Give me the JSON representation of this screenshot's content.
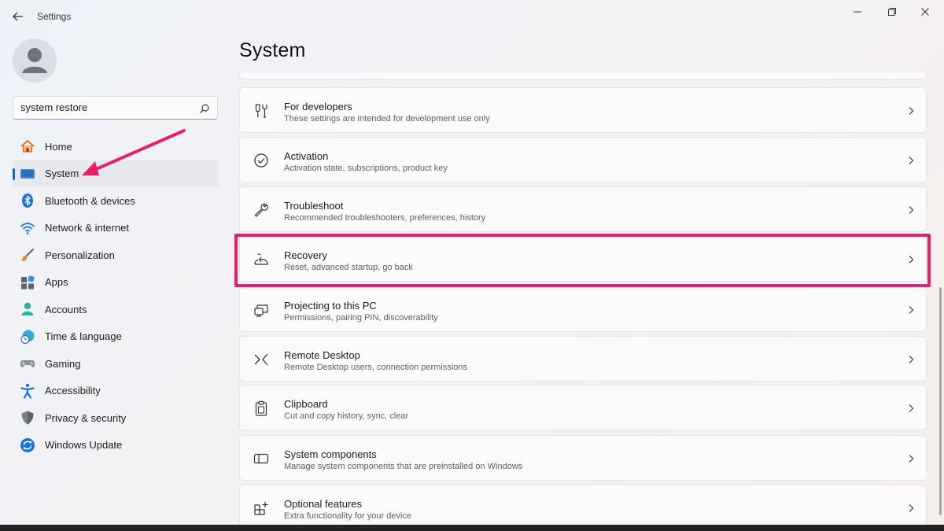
{
  "window": {
    "title": "Settings",
    "back_icon": "back-arrow-icon",
    "controls": [
      "minimize-icon",
      "maximize-icon",
      "close-icon"
    ]
  },
  "search": {
    "value": "system restore",
    "icon": "search-icon"
  },
  "sidebar": {
    "items": [
      {
        "label": "Home",
        "icon": "home-icon",
        "active": false
      },
      {
        "label": "System",
        "icon": "monitor-icon",
        "active": true
      },
      {
        "label": "Bluetooth & devices",
        "icon": "bluetooth-icon",
        "active": false
      },
      {
        "label": "Network & internet",
        "icon": "wifi-icon",
        "active": false
      },
      {
        "label": "Personalization",
        "icon": "brush-icon",
        "active": false
      },
      {
        "label": "Apps",
        "icon": "apps-icon",
        "active": false
      },
      {
        "label": "Accounts",
        "icon": "person-icon",
        "active": false
      },
      {
        "label": "Time & language",
        "icon": "globe-clock-icon",
        "active": false
      },
      {
        "label": "Gaming",
        "icon": "gamepad-icon",
        "active": false
      },
      {
        "label": "Accessibility",
        "icon": "accessibility-icon",
        "active": false
      },
      {
        "label": "Privacy & security",
        "icon": "shield-icon",
        "active": false
      },
      {
        "label": "Windows Update",
        "icon": "update-icon",
        "active": false
      }
    ]
  },
  "main": {
    "title": "System",
    "items": [
      {
        "title": "For developers",
        "subtitle": "These settings are intended for development use only",
        "icon": "developer-tools-icon"
      },
      {
        "title": "Activation",
        "subtitle": "Activation state, subscriptions, product key",
        "icon": "check-circle-icon"
      },
      {
        "title": "Troubleshoot",
        "subtitle": "Recommended troubleshooters, preferences, history",
        "icon": "wrench-icon"
      },
      {
        "title": "Recovery",
        "subtitle": "Reset, advanced startup, go back",
        "icon": "recovery-icon",
        "highlighted": true
      },
      {
        "title": "Projecting to this PC",
        "subtitle": "Permissions, pairing PIN, discoverability",
        "icon": "projecting-icon"
      },
      {
        "title": "Remote Desktop",
        "subtitle": "Remote Desktop users, connection permissions",
        "icon": "remote-desktop-icon"
      },
      {
        "title": "Clipboard",
        "subtitle": "Cut and copy history, sync, clear",
        "icon": "clipboard-icon"
      },
      {
        "title": "System components",
        "subtitle": "Manage system components that are preinstalled on Windows",
        "icon": "system-components-icon"
      },
      {
        "title": "Optional features",
        "subtitle": "Extra functionality for your device",
        "icon": "optional-features-icon"
      }
    ]
  },
  "colors": {
    "accent": "#1269b8",
    "annotation": "#e8206b"
  }
}
